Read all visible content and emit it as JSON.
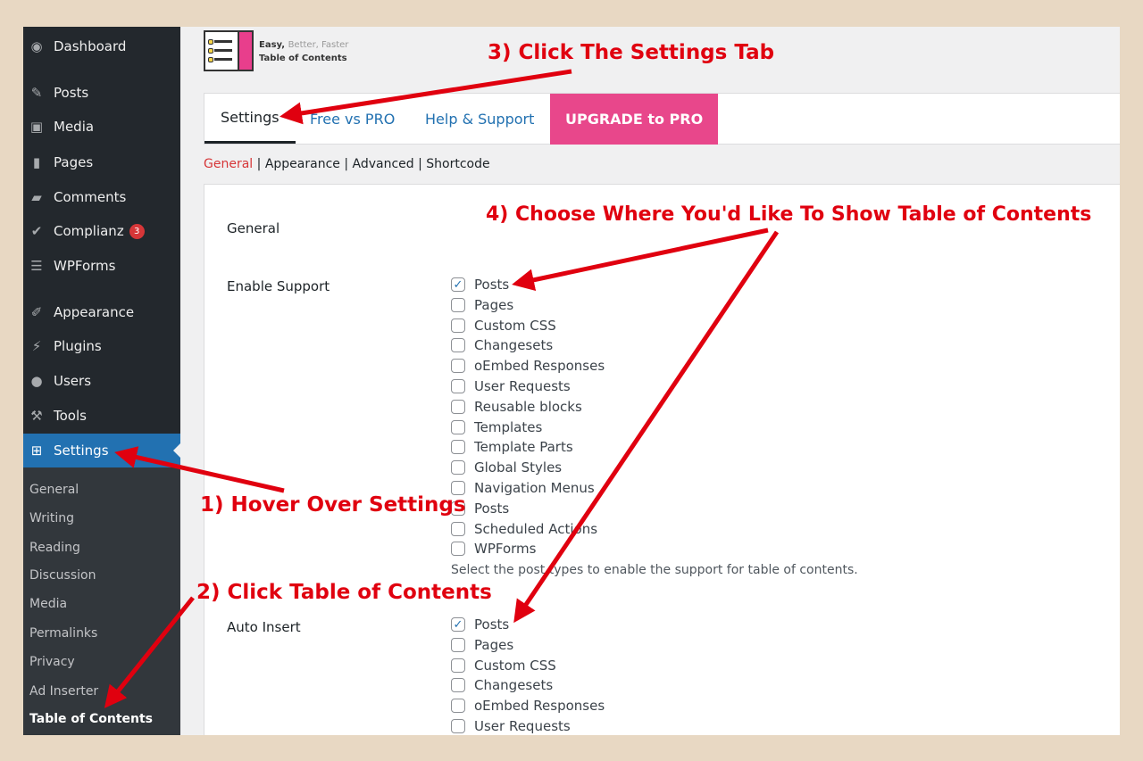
{
  "sidebar": {
    "menu": [
      {
        "label": "Dashboard",
        "icon": "dashboard-icon"
      },
      {
        "label": "Posts",
        "icon": "pin-icon"
      },
      {
        "label": "Media",
        "icon": "media-icon"
      },
      {
        "label": "Pages",
        "icon": "pages-icon"
      },
      {
        "label": "Comments",
        "icon": "comment-icon"
      },
      {
        "label": "Complianz",
        "icon": "check-icon",
        "badge": "3"
      },
      {
        "label": "WPForms",
        "icon": "form-icon"
      },
      {
        "label": "Appearance",
        "icon": "brush-icon"
      },
      {
        "label": "Plugins",
        "icon": "plugin-icon"
      },
      {
        "label": "Users",
        "icon": "user-icon"
      },
      {
        "label": "Tools",
        "icon": "wrench-icon"
      },
      {
        "label": "Settings",
        "icon": "settings-icon"
      }
    ],
    "submenu": [
      "General",
      "Writing",
      "Reading",
      "Discussion",
      "Media",
      "Permalinks",
      "Privacy",
      "Ad Inserter",
      "Table of Contents"
    ]
  },
  "brand": {
    "tag_easy": "Easy,",
    "tag_rest": "Better, Faster",
    "name": "Table of Contents"
  },
  "tabs": [
    {
      "label": "Settings"
    },
    {
      "label": "Free vs PRO"
    },
    {
      "label": "Help & Support"
    },
    {
      "label": "UPGRADE to PRO"
    }
  ],
  "subtabs": {
    "general": "General",
    "appearance": "Appearance",
    "advanced": "Advanced",
    "shortcode": "Shortcode",
    "separator": "|"
  },
  "panel": {
    "section_title": "General",
    "enable_support": {
      "label": "Enable Support",
      "options": [
        {
          "label": "Posts",
          "checked": true
        },
        {
          "label": "Pages",
          "checked": false
        },
        {
          "label": "Custom CSS",
          "checked": false
        },
        {
          "label": "Changesets",
          "checked": false
        },
        {
          "label": "oEmbed Responses",
          "checked": false
        },
        {
          "label": "User Requests",
          "checked": false
        },
        {
          "label": "Reusable blocks",
          "checked": false
        },
        {
          "label": "Templates",
          "checked": false
        },
        {
          "label": "Template Parts",
          "checked": false
        },
        {
          "label": "Global Styles",
          "checked": false
        },
        {
          "label": "Navigation Menus",
          "checked": false
        },
        {
          "label": "Posts",
          "checked": false
        },
        {
          "label": "Scheduled Actions",
          "checked": false
        },
        {
          "label": "WPForms",
          "checked": false
        }
      ],
      "help": "Select the post types to enable the support for table of contents."
    },
    "auto_insert": {
      "label": "Auto Insert",
      "options": [
        {
          "label": "Posts",
          "checked": true
        },
        {
          "label": "Pages",
          "checked": false
        },
        {
          "label": "Custom CSS",
          "checked": false
        },
        {
          "label": "Changesets",
          "checked": false
        },
        {
          "label": "oEmbed Responses",
          "checked": false
        },
        {
          "label": "User Requests",
          "checked": false
        }
      ]
    }
  },
  "annotations": {
    "step1": "1) Hover Over Settings",
    "step2": "2) Click Table of Contents",
    "step3": "3) Click The Settings Tab",
    "step4": "4) Choose Where You'd Like To Show Table of Contents"
  },
  "colors": {
    "sidebar_bg": "#23282d",
    "accent_blue": "#2271b1",
    "upgrade_pink": "#e8478b",
    "annotation_red": "#e0000f",
    "backdrop": "#e8d8c3"
  }
}
